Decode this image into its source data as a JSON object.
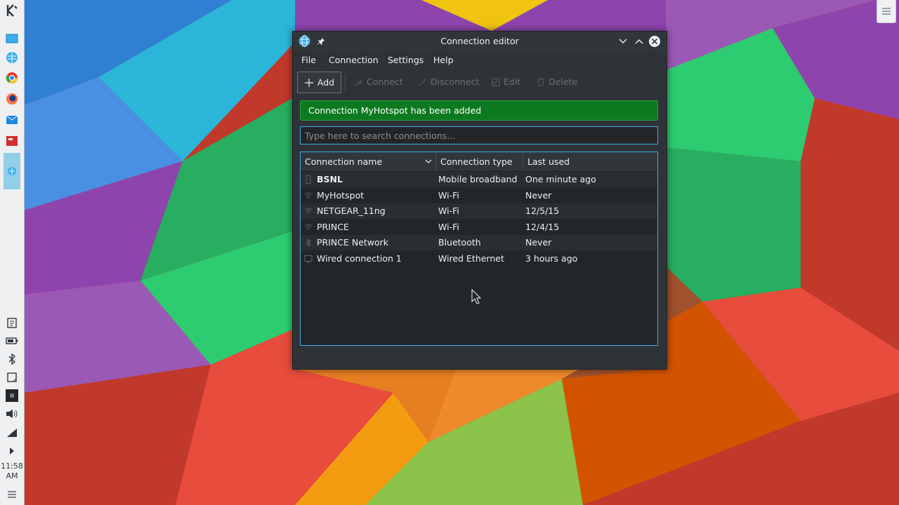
{
  "panel": {
    "clock_time": "11:58",
    "clock_ampm": "AM",
    "launchers": [
      "kde-logo-icon",
      "desktop-icon",
      "network-globe-icon",
      "chrome-icon",
      "firefox-icon",
      "mail-icon",
      "presentation-icon",
      "network-manager-icon"
    ],
    "tray": [
      "clipboard-icon",
      "battery-icon",
      "bluetooth-icon",
      "notes-icon",
      "media-icon",
      "volume-icon",
      "wifi-signal-icon",
      "expand-arrow-icon"
    ]
  },
  "window": {
    "title": "Connection editor",
    "menu": [
      "File",
      "Connection",
      "Settings",
      "Help"
    ],
    "toolbar": {
      "add": "Add",
      "connect": "Connect",
      "disconnect": "Disconnect",
      "edit": "Edit",
      "delete": "Delete"
    },
    "message": "Connection MyHotspot has been added",
    "search": {
      "placeholder": "Type here to search connections...",
      "value": ""
    },
    "columns": [
      "Connection name",
      "Connection type",
      "Last used"
    ],
    "rows": [
      {
        "name": "BSNL",
        "type": "Mobile broadband",
        "last_used": "One minute ago",
        "icon": "mobile-broadband-icon",
        "bold": true
      },
      {
        "name": "MyHotspot",
        "type": "Wi-Fi",
        "last_used": "Never",
        "icon": "wifi-icon"
      },
      {
        "name": "NETGEAR_11ng",
        "type": "Wi-Fi",
        "last_used": "12/5/15",
        "icon": "wifi-icon"
      },
      {
        "name": "PRINCE",
        "type": "Wi-Fi",
        "last_used": "12/4/15",
        "icon": "wifi-icon"
      },
      {
        "name": "PRINCE Network",
        "type": "Bluetooth",
        "last_used": "Never",
        "icon": "bluetooth-icon"
      },
      {
        "name": "Wired connection 1",
        "type": "Wired Ethernet",
        "last_used": "3 hours ago",
        "icon": "ethernet-icon"
      }
    ]
  },
  "colors": {
    "accent": "#3daee9",
    "success_bg": "#0d7a1f",
    "window_bg": "#2f3338",
    "list_bg": "#232629"
  }
}
